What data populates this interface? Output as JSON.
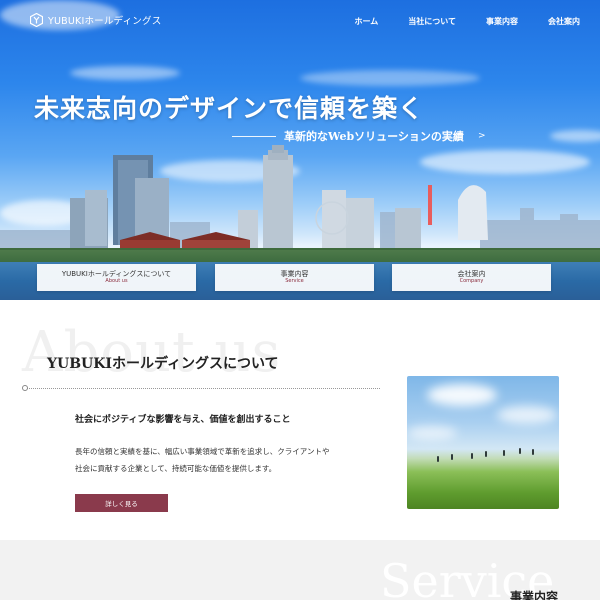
{
  "header": {
    "logo_text": "YUBUKIホールディングス",
    "logo_icon": "hexagon-logo-icon",
    "nav": [
      {
        "label": "ホーム"
      },
      {
        "label": "当社について"
      },
      {
        "label": "事業内容"
      },
      {
        "label": "会社案内"
      }
    ]
  },
  "hero": {
    "headline": "未来志向のデザインで信頼を築く",
    "subheadline": "革新的なWebソリューションの実績",
    "subheadline_arrow": ">",
    "cards": [
      {
        "label": "YUBUKIホールディングスについて",
        "sublabel": "About us"
      },
      {
        "label": "事業内容",
        "sublabel": "Service"
      },
      {
        "label": "会社案内",
        "sublabel": "Company"
      }
    ]
  },
  "about": {
    "bg_word": "About us",
    "title": "YUBUKIホールディングスについて",
    "heading": "社会にポジティブな影響を与え、価値を創出すること",
    "body_lines": [
      "長年の信頼と実績を基に、幅広い事業領域で革新を追求し、クライアントや",
      "社会に貢献する企業として、持続可能な価値を提供します。"
    ],
    "button_label": "詳しく見る"
  },
  "service": {
    "bg_word": "Service",
    "title": "事業内容"
  },
  "colors": {
    "accent": "#8a3a4c",
    "sky_top": "#1d6fe0",
    "section_gray": "#f2f2f2"
  }
}
